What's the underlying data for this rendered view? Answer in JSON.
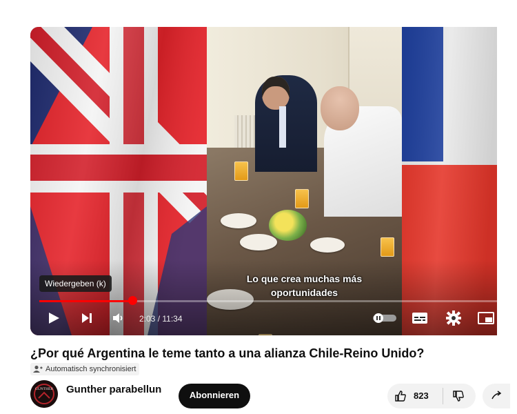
{
  "video": {
    "subtitle_line1": "Lo que crea muchas más",
    "subtitle_line2": "oportunidades",
    "tooltip": "Wiedergeben (k)",
    "time_display": "2:03 / 11:34",
    "progress": 0.203
  },
  "controls": {
    "play_icon": "play-icon",
    "next_icon": "next-icon",
    "volume_icon": "volume-icon",
    "autoplay_icon": "autoplay-toggle-icon",
    "cc_icon": "subtitles-icon",
    "settings_icon": "gear-icon",
    "miniplayer_icon": "miniplayer-icon"
  },
  "info": {
    "title": "¿Por qué Argentina le teme tanto a una alianza Chile-Reino Unido?",
    "sync_badge": "Automatisch synchronisiert",
    "channel_name": "Gunther parabellun",
    "avatar_text": "GUNTHER",
    "subscribe_label": "Abonnieren",
    "like_count": "823"
  },
  "colors": {
    "accent": "#ff0000",
    "subscribe_bg": "#0f0f0f"
  }
}
